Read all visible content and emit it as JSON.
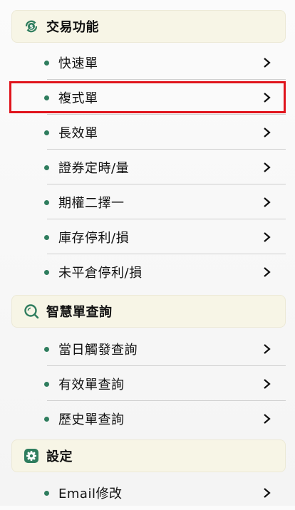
{
  "sections": [
    {
      "title": "交易功能",
      "icon": "dollar-refresh-icon",
      "items": [
        "快速單",
        "複式單",
        "長效單",
        "證券定時/量",
        "期權二擇一",
        "庫存停利/損",
        "未平倉停利/損"
      ]
    },
    {
      "title": "智慧單查詢",
      "icon": "search-icon",
      "items": [
        "當日觸發查詢",
        "有效單查詢",
        "歷史單查詢"
      ]
    },
    {
      "title": "設定",
      "icon": "gear-icon",
      "items": [
        "Email修改"
      ]
    }
  ],
  "selected_item": "複式單",
  "colors": {
    "accent_green": "#2f7d5e",
    "header_bg": "#f7f5e6",
    "highlight_border": "#e0141c"
  }
}
